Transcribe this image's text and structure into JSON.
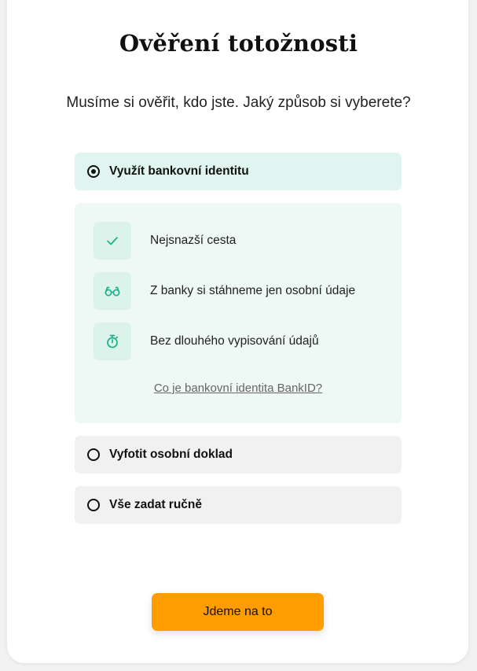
{
  "page": {
    "title": "Ověření totožnosti",
    "subtitle": "Musíme si ověřit, kdo jste. Jaký způsob si vyberete?"
  },
  "options": [
    {
      "label": "Využít bankovní identitu",
      "selected": true
    },
    {
      "label": "Vyfotit osobní doklad",
      "selected": false
    },
    {
      "label": "Vše zadat ručně",
      "selected": false
    }
  ],
  "bank_identity_panel": {
    "features": [
      {
        "icon": "check-icon",
        "text": "Nejsnazší cesta"
      },
      {
        "icon": "glasses-icon",
        "text": "Z banky si stáhneme jen osobní údaje"
      },
      {
        "icon": "stopwatch-icon",
        "text": "Bez dlouhého vypisování údajů"
      }
    ],
    "link": "Co je bankovní identita BankID?"
  },
  "cta": {
    "label": "Jdeme na to"
  },
  "colors": {
    "accent": "#ff9d00",
    "icon": "#1fb08a",
    "selected_bg": "#e0f5f0",
    "panel_bg": "#eef8f5"
  }
}
